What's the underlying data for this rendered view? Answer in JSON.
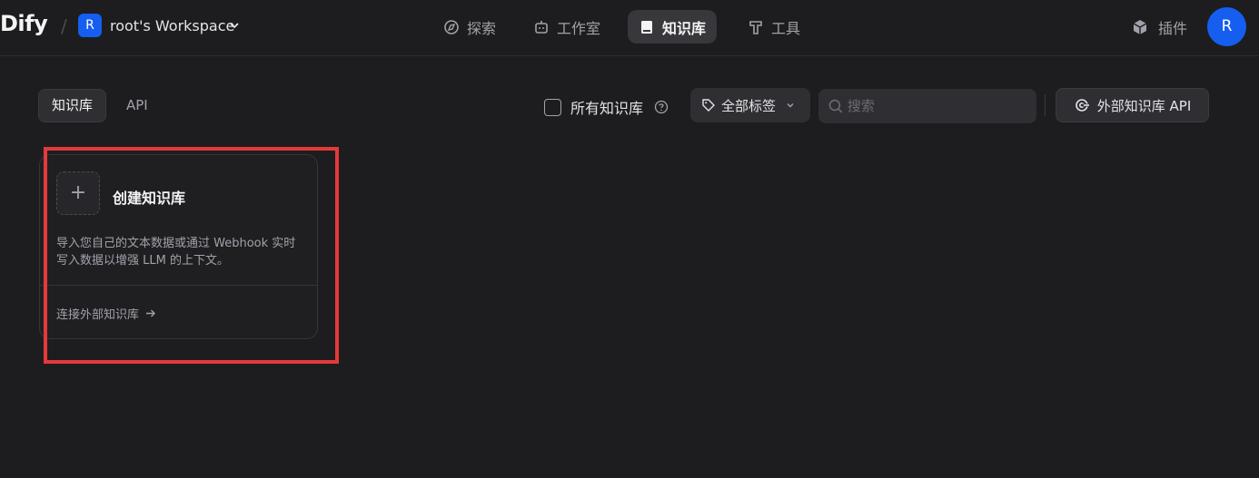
{
  "header": {
    "logo": "Dify",
    "separator": "/",
    "workspace_initial": "R",
    "workspace_name": "root's Workspace",
    "nav": [
      {
        "label": "探索",
        "icon": "explore-icon"
      },
      {
        "label": "工作室",
        "icon": "robot-icon"
      },
      {
        "label": "知识库",
        "icon": "book-icon",
        "active": true
      },
      {
        "label": "工具",
        "icon": "hammer-icon"
      }
    ],
    "plugins_label": "插件",
    "user_initial": "R"
  },
  "toolbar": {
    "tabs": [
      {
        "label": "知识库",
        "active": true
      },
      {
        "label": "API",
        "active": false
      }
    ],
    "all_datasets_label": "所有知识库",
    "tag_filter_label": "全部标签",
    "search_placeholder": "搜索",
    "external_api_label": "外部知识库 API"
  },
  "card": {
    "plus": "+",
    "title": "创建知识库",
    "description": "导入您自己的文本数据或通过 Webhook 实时写入数据以增强 LLM 的上下文。",
    "link_label": "连接外部知识库"
  },
  "colors": {
    "background": "#1d1d1f",
    "accent": "#155eef",
    "highlight": "#e5393a"
  }
}
